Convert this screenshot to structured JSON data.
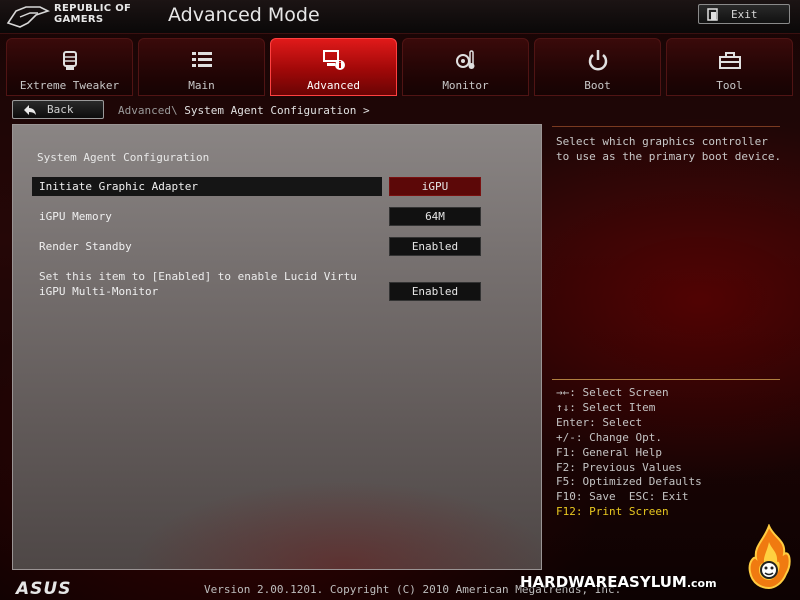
{
  "header": {
    "brand_line1": "REPUBLIC OF",
    "brand_line2": "GAMERS",
    "mode_title": "Advanced Mode",
    "exit_label": "Exit"
  },
  "tabs": [
    {
      "label": "Extreme Tweaker",
      "icon": "tweaker-icon",
      "active": false
    },
    {
      "label": "Main",
      "icon": "list-icon",
      "active": false
    },
    {
      "label": "Advanced",
      "icon": "advanced-icon",
      "active": true
    },
    {
      "label": "Monitor",
      "icon": "thermometer-icon",
      "active": false
    },
    {
      "label": "Boot",
      "icon": "power-icon",
      "active": false
    },
    {
      "label": "Tool",
      "icon": "toolbox-icon",
      "active": false
    }
  ],
  "nav": {
    "back_label": "Back",
    "crumb_parent": "Advanced\\",
    "crumb_current": "System Agent Configuration >"
  },
  "main": {
    "section_title": "System Agent Configuration",
    "rows": [
      {
        "label": "Initiate Graphic Adapter",
        "value": "iGPU"
      },
      {
        "label": "iGPU Memory",
        "value": "64M"
      },
      {
        "label": "Render Standby",
        "value": "Enabled"
      },
      {
        "label": "iGPU Multi-Monitor",
        "value": "Enabled"
      }
    ],
    "note": "Set this item to [Enabled] to enable Lucid Virtu"
  },
  "help": {
    "text": "Select which graphics controller to use as the primary boot device."
  },
  "keys": [
    "→←: Select Screen",
    "↑↓: Select Item",
    "Enter: Select",
    "+/-: Change Opt.",
    "F1: General Help",
    "F2: Previous Values",
    "F5: Optimized Defaults",
    "F10: Save  ESC: Exit",
    "F12: Print Screen"
  ],
  "footer": {
    "asus_logo": "ASUS",
    "version": "Version 2.00.1201. Copyright (C) 2010 American Megatrends, Inc.",
    "watermark": "HARDWAREASYLUM",
    "watermark_suffix": ".com"
  },
  "colors": {
    "accent_red": "#e01a1a",
    "selected_value_bg": "#5c0808",
    "highlight_key": "#e8c820"
  }
}
